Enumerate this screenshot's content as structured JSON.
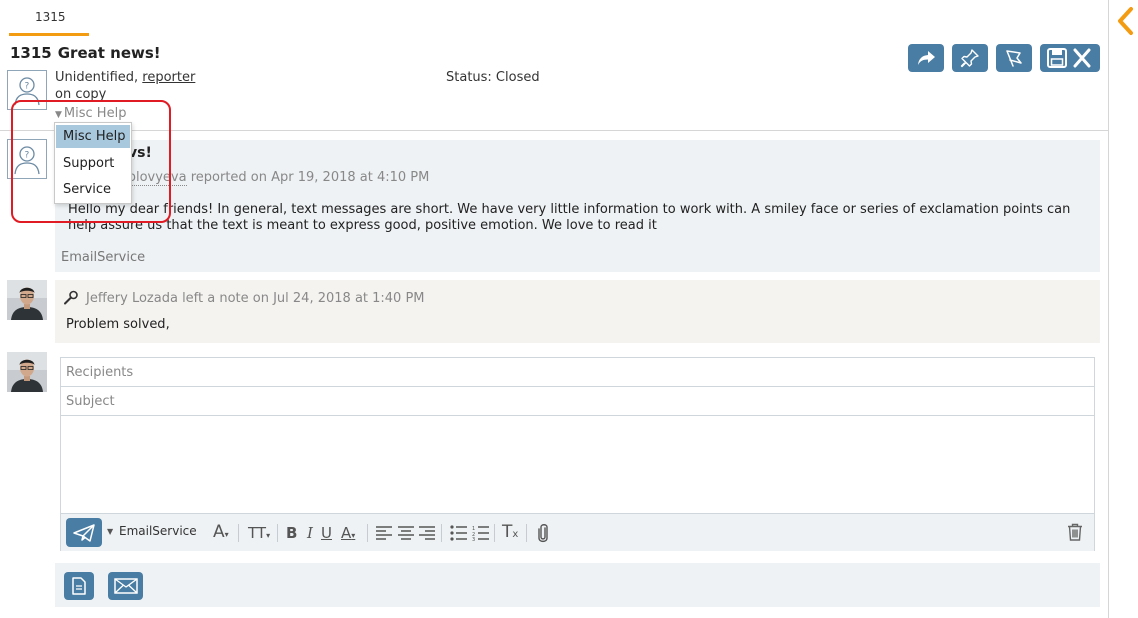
{
  "tab": {
    "label": "1315"
  },
  "ticket": {
    "number": "1315",
    "title": "Great news!",
    "requester": "Unidentified,",
    "requester_role": "reporter",
    "on_copy": "on copy",
    "status": "Status: Closed",
    "category": "Misc Help"
  },
  "category_dropdown": {
    "options": [
      "Misc Help",
      "Support",
      "Service"
    ],
    "selected": "Misc Help"
  },
  "message": {
    "title_visible": "vs!",
    "author_visible": "olovyeva",
    "action": " reported on Apr 19, 2018 at 4:10 PM",
    "body": "Hello my dear friends! In general, text messages are short. We have very little information to work with. A smiley face or series of exclamation points can help assure us that the text is meant to express good, positive emotion. We love to read it",
    "source": "EmailService"
  },
  "note": {
    "author_line": "Jeffery Lozada left a note on Jul 24, 2018 at 1:40 PM",
    "body": "Problem solved,"
  },
  "compose": {
    "recipients_placeholder": "Recipients",
    "subject_placeholder": "Subject",
    "send_channel": "EmailService"
  },
  "icons": {
    "forward": "forward-icon",
    "pin": "pin-icon",
    "flag": "flag-icon",
    "save_close": "save-close-icon",
    "collapse": "chevron-left-icon",
    "send": "paper-plane-icon",
    "trash": "trash-icon",
    "note": "document-icon",
    "email": "envelope-icon"
  },
  "colors": {
    "accent": "#f39c12",
    "button": "#4a7da3",
    "card_bg": "#eef2f4",
    "note_bg": "#f5f3f0",
    "highlight": "#e01b24",
    "selected_option": "#a8c8de"
  }
}
